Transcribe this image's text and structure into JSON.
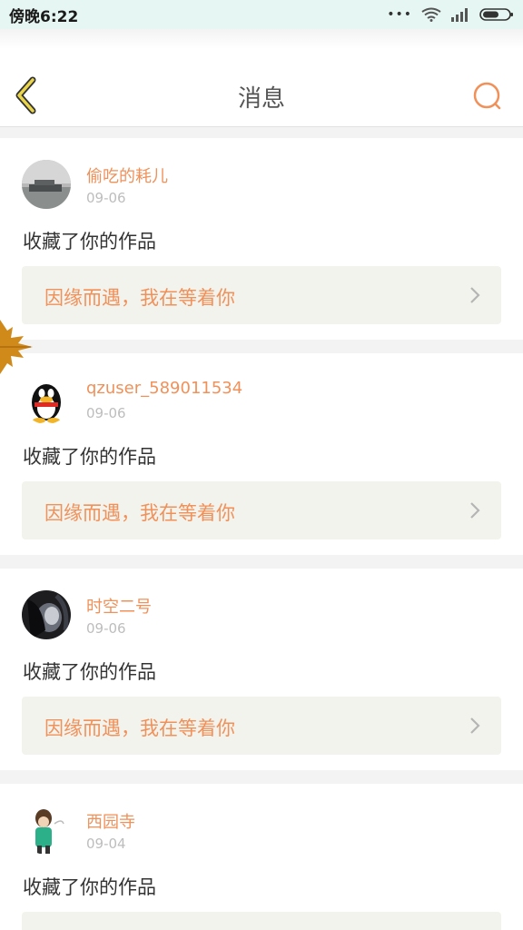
{
  "status_bar": {
    "time": "傍晚6:22",
    "dots": "•••"
  },
  "header": {
    "title": "消息"
  },
  "messages": [
    {
      "user": "偷吃的耗儿",
      "date": "09-06",
      "action": "收藏了你的作品",
      "work": "因缘而遇，我在等着你"
    },
    {
      "user": "qzuser_589011534",
      "date": "09-06",
      "action": "收藏了你的作品",
      "work": "因缘而遇，我在等着你"
    },
    {
      "user": "时空二号",
      "date": "09-06",
      "action": "收藏了你的作品",
      "work": "因缘而遇，我在等着你"
    },
    {
      "user": "西园寺",
      "date": "09-04",
      "action": "收藏了你的作品",
      "work": ""
    }
  ],
  "colors": {
    "accent": "#f0915a",
    "back_icon": "#e9d44a",
    "background": "#f3f3f3"
  }
}
